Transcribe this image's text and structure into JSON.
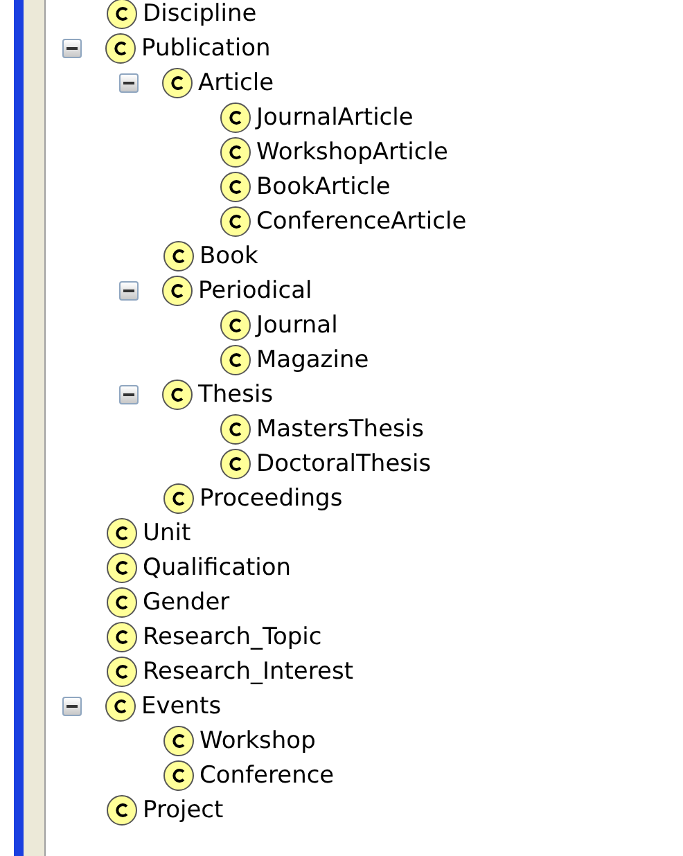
{
  "tree": [
    {
      "label": "Discipline"
    },
    {
      "label": "Publication",
      "expanded": true,
      "children": [
        {
          "label": "Article",
          "expanded": true,
          "children": [
            {
              "label": "JournalArticle"
            },
            {
              "label": "WorkshopArticle"
            },
            {
              "label": "BookArticle"
            },
            {
              "label": "ConferenceArticle"
            }
          ]
        },
        {
          "label": "Book"
        },
        {
          "label": "Periodical",
          "expanded": true,
          "children": [
            {
              "label": "Journal"
            },
            {
              "label": "Magazine"
            }
          ]
        },
        {
          "label": "Thesis",
          "expanded": true,
          "children": [
            {
              "label": "MastersThesis"
            },
            {
              "label": "DoctoralThesis"
            }
          ]
        },
        {
          "label": "Proceedings"
        }
      ]
    },
    {
      "label": "Unit"
    },
    {
      "label": "Qualification"
    },
    {
      "label": "Gender"
    },
    {
      "label": "Research_Topic"
    },
    {
      "label": "Research_Interest"
    },
    {
      "label": "Events",
      "expanded": true,
      "children": [
        {
          "label": "Workshop"
        },
        {
          "label": "Conference"
        }
      ]
    },
    {
      "label": "Project"
    }
  ]
}
